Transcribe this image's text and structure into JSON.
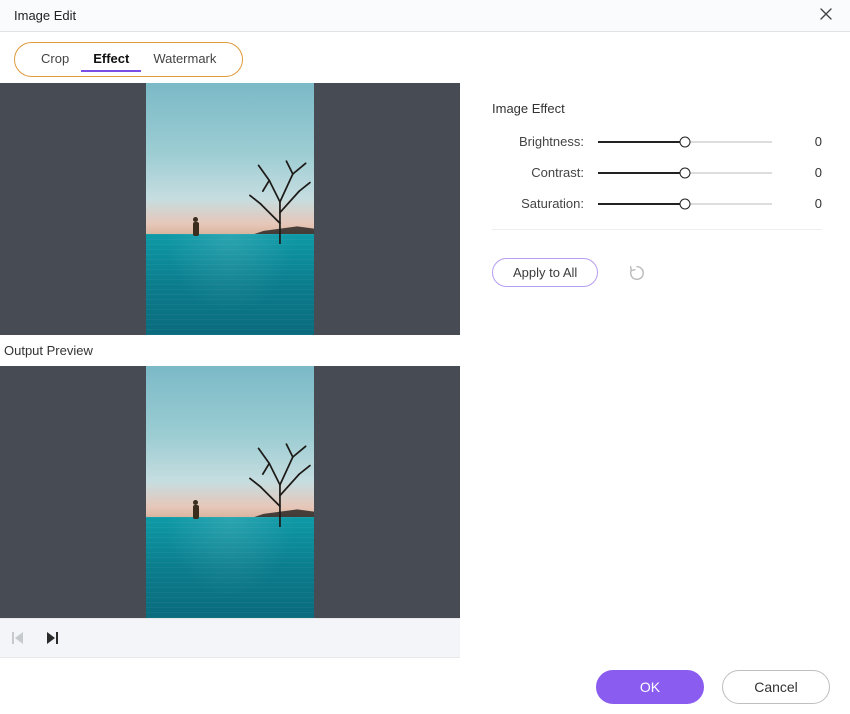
{
  "window": {
    "title": "Image Edit"
  },
  "tabs": {
    "crop": "Crop",
    "effect": "Effect",
    "watermark": "Watermark",
    "active": "effect"
  },
  "preview": {
    "output_label": "Output Preview"
  },
  "effect_panel": {
    "heading": "Image Effect",
    "sliders": {
      "brightness": {
        "label": "Brightness:",
        "value": "0"
      },
      "contrast": {
        "label": "Contrast:",
        "value": "0"
      },
      "saturation": {
        "label": "Saturation:",
        "value": "0"
      }
    },
    "apply_all": "Apply to All"
  },
  "footer": {
    "ok": "OK",
    "cancel": "Cancel"
  }
}
